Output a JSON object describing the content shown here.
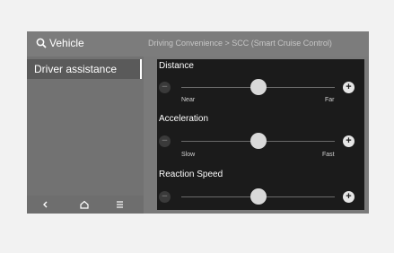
{
  "header": {
    "search_label": "Vehicle",
    "breadcrumb": "Driving Convenience > SCC (Smart Cruise Control)"
  },
  "sidebar": {
    "items": [
      {
        "label": "Driver assistance"
      }
    ]
  },
  "bottom_nav": {
    "icons": [
      "back-icon",
      "home-icon",
      "menu-icon"
    ]
  },
  "settings": [
    {
      "title": "Distance",
      "min_label": "Near",
      "max_label": "Far",
      "level": 0.5
    },
    {
      "title": "Acceleration",
      "min_label": "Slow",
      "max_label": "Fast",
      "level": 0.5
    },
    {
      "title": "Reaction Speed",
      "min_label": "",
      "max_label": "",
      "level": 0.5
    }
  ],
  "controls": {
    "minus": "−",
    "plus": "+"
  }
}
